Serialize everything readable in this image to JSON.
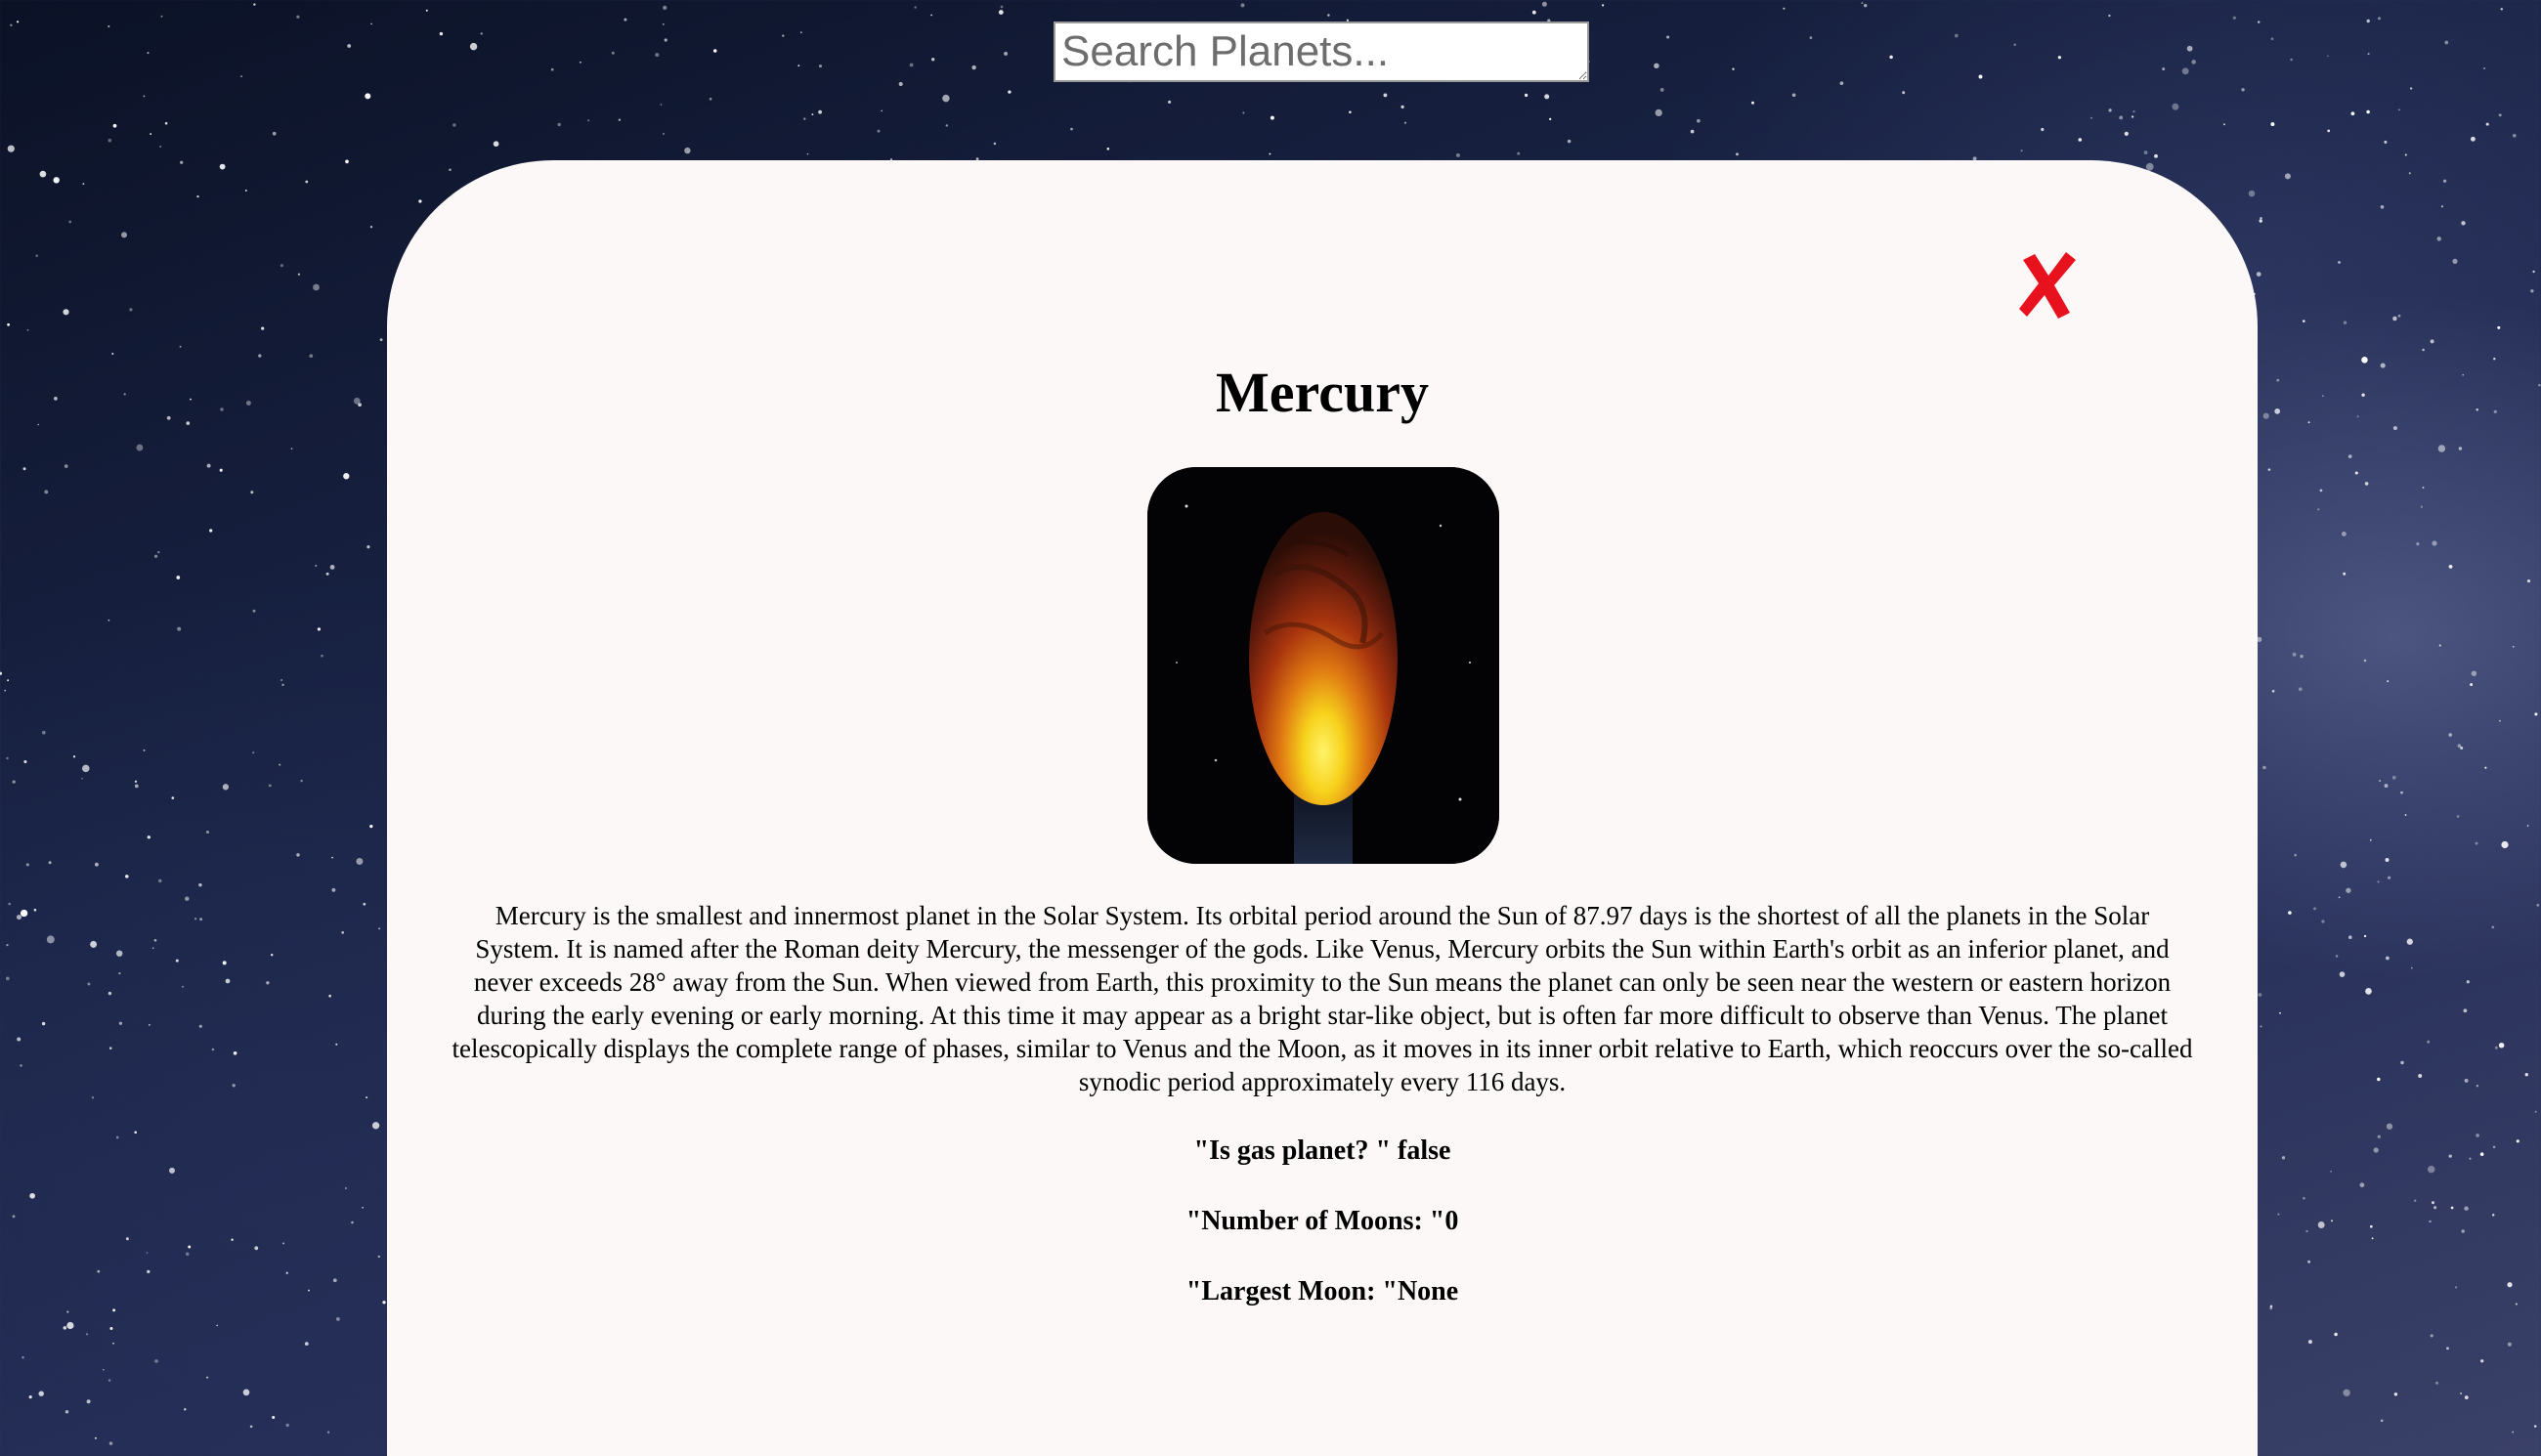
{
  "search": {
    "placeholder": "Search Planets..."
  },
  "planet": {
    "name": "Mercury",
    "description": "Mercury is the smallest and innermost planet in the Solar System. Its orbital period around the Sun of 87.97 days is the shortest of all the planets in the Solar System. It is named after the Roman deity Mercury, the messenger of the gods. Like Venus, Mercury orbits the Sun within Earth's orbit as an inferior planet, and never exceeds 28° away from the Sun. When viewed from Earth, this proximity to the Sun means the planet can only be seen near the western or eastern horizon during the early evening or early morning. At this time it may appear as a bright star-like object, but is often far more difficult to observe than Venus. The planet telescopically displays the complete range of phases, similar to Venus and the Moon, as it moves in its inner orbit relative to Earth, which reoccurs over the so-called synodic period approximately every 116 days.",
    "facts": {
      "gas_planet": "\"Is gas planet? \" false",
      "moons": "\"Number of Moons: \"0",
      "largest_moon": "\"Largest Moon: \"None"
    }
  },
  "icons": {
    "close": "close-x-icon"
  },
  "colors": {
    "close": "#e8121e",
    "modal_background": "#fcf8f8"
  }
}
